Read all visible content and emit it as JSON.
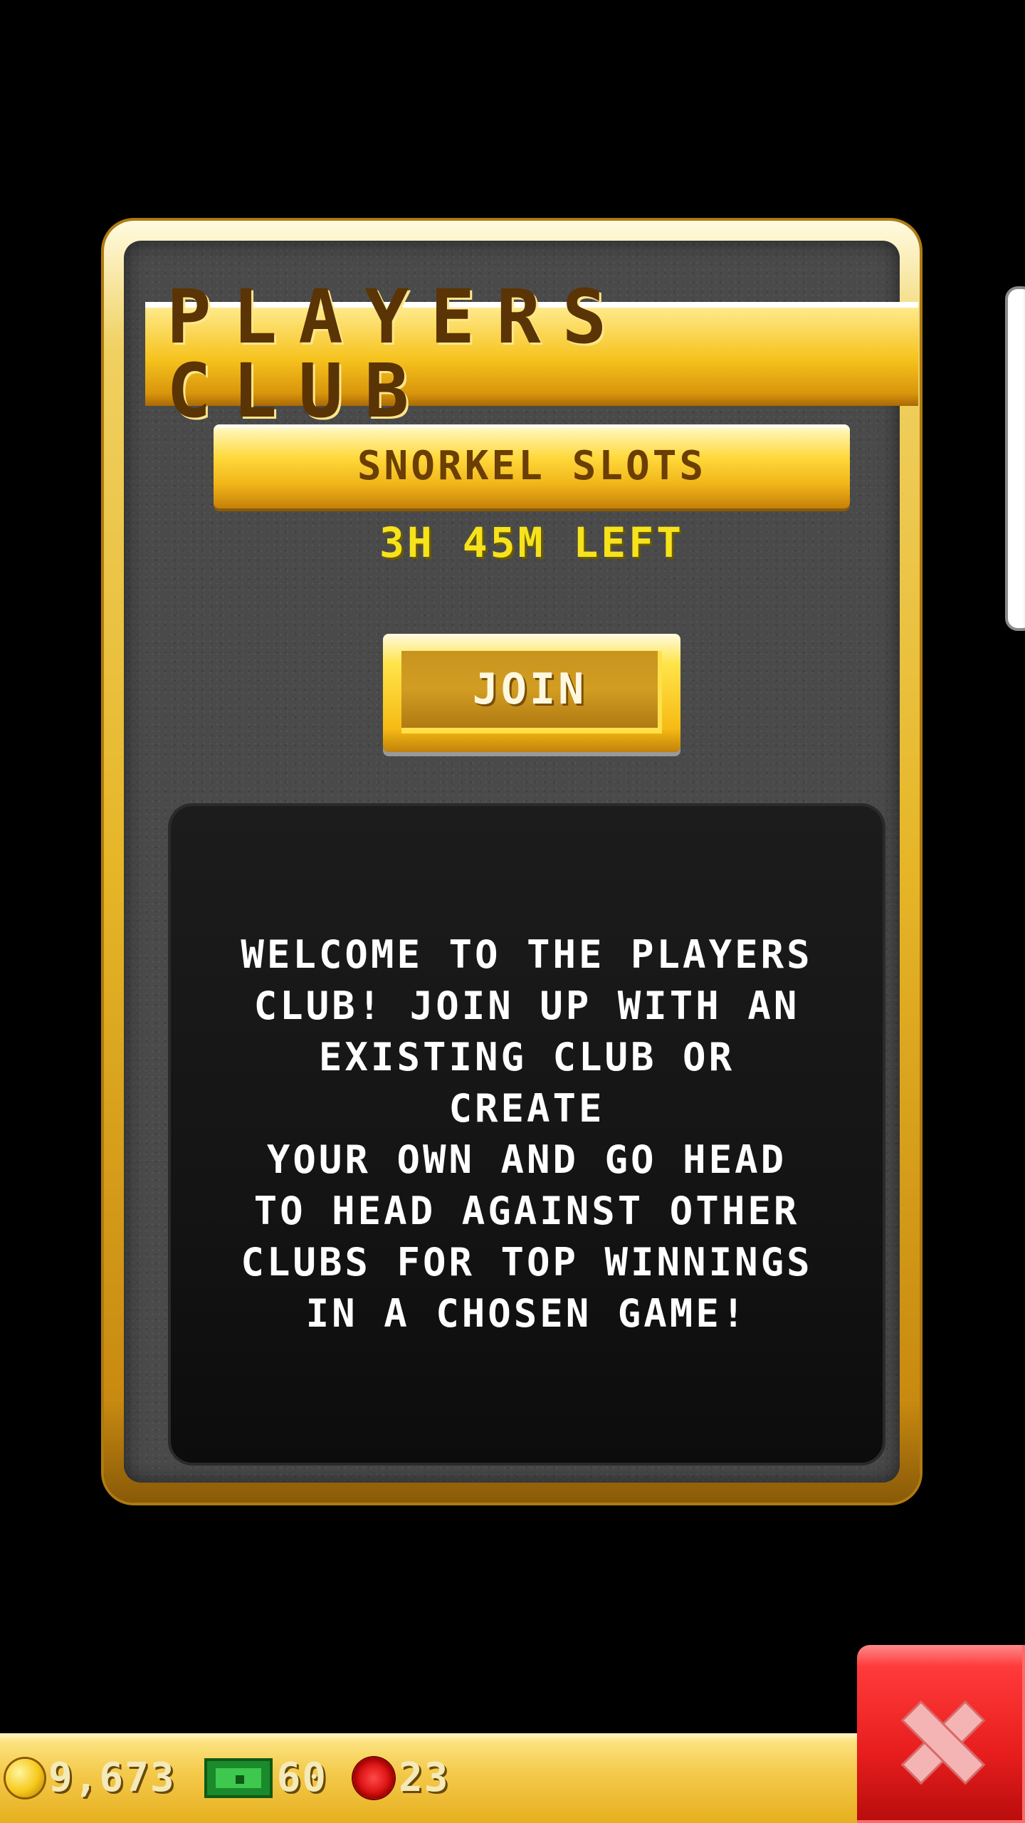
{
  "panel": {
    "title": "PLAYERS CLUB",
    "game_name": "SNORKEL SLOTS",
    "time_left": "3H 45M LEFT",
    "join_label": "JOIN",
    "description": "WELCOME TO THE PLAYERS\nCLUB! JOIN UP WITH AN\nEXISTING CLUB OR CREATE\nYOUR OWN AND GO HEAD\nTO HEAD AGAINST OTHER\nCLUBS FOR TOP WINNINGS\nIN A CHOSEN GAME!"
  },
  "status_bar": {
    "coins": "9,673",
    "cash": "60",
    "chips": "23",
    "icons": [
      "coin-icon",
      "cash-icon",
      "chip-icon"
    ]
  },
  "close_button": {
    "icon": "close-icon"
  },
  "colors": {
    "gold": "#f6c31e",
    "time_text": "#f6e31c",
    "close_red": "#e81e1e",
    "cash_green": "#1a8a2a"
  }
}
